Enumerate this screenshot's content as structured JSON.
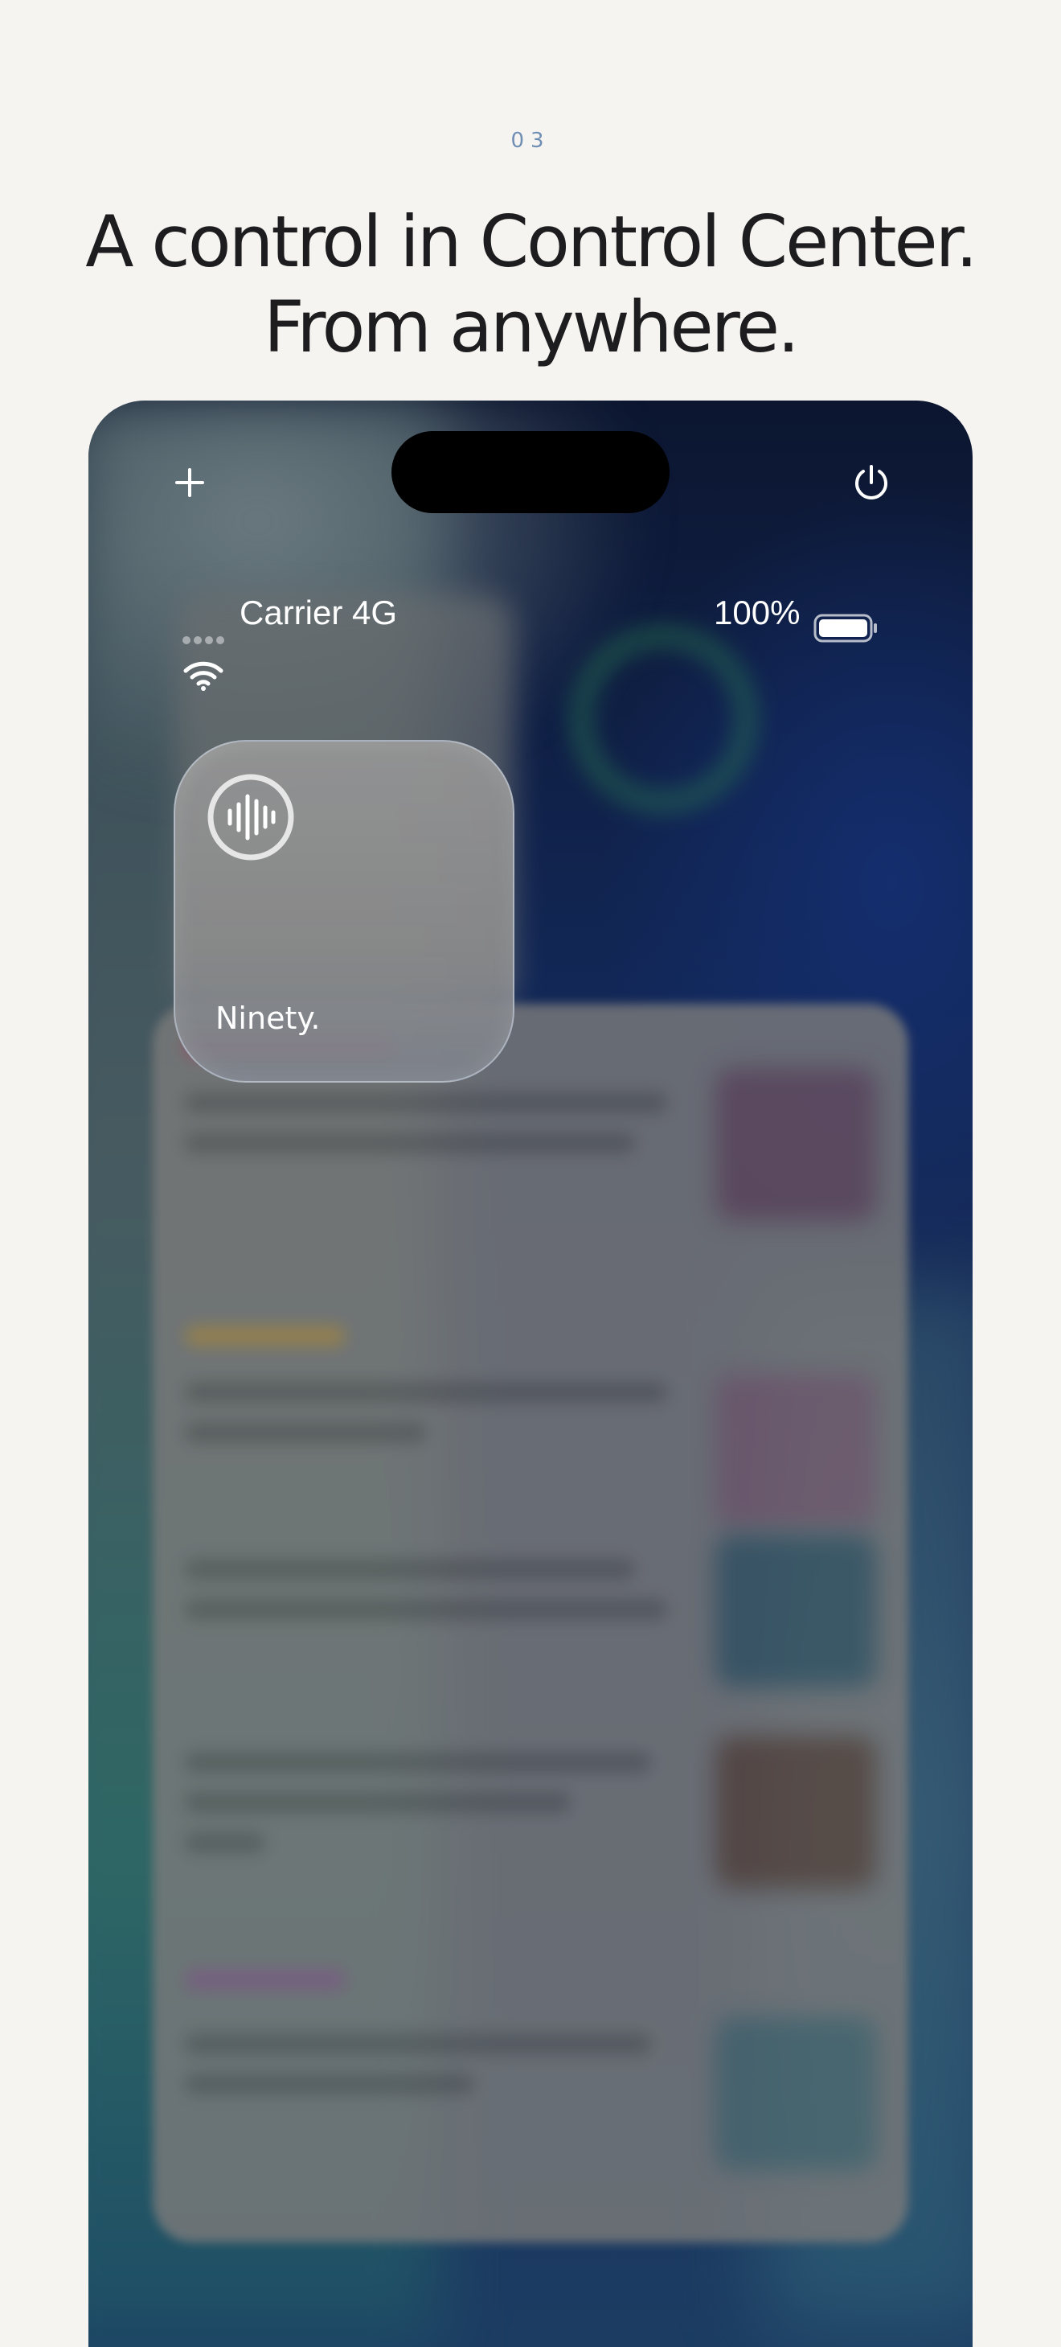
{
  "section": {
    "step": "03"
  },
  "headline": {
    "line1": "A control in Control Center.",
    "line2": "From anywhere."
  },
  "phone": {
    "status_bar": {
      "carrier": "Carrier 4G",
      "battery": "100%"
    },
    "top_controls": {
      "add_icon": "plus-icon",
      "power_icon": "power-icon"
    },
    "control_widget": {
      "label": "Ninety.",
      "icon": "waveform-icon"
    }
  }
}
